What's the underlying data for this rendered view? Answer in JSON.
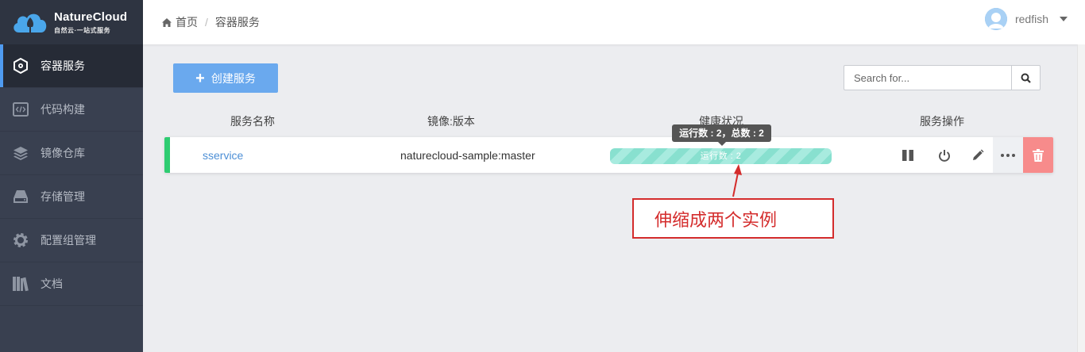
{
  "app": {
    "logo_title": "NatureCloud",
    "logo_subtitle": "自然云·一站式服务"
  },
  "sidebar": {
    "items": [
      {
        "label": "容器服务",
        "icon": "cube-icon",
        "active": true
      },
      {
        "label": "代码构建",
        "icon": "code-icon",
        "active": false
      },
      {
        "label": "镜像仓库",
        "icon": "layers-icon",
        "active": false
      },
      {
        "label": "存储管理",
        "icon": "disk-icon",
        "active": false
      },
      {
        "label": "配置组管理",
        "icon": "gear-icon",
        "active": false
      },
      {
        "label": "文档",
        "icon": "books-icon",
        "active": false
      }
    ]
  },
  "header": {
    "breadcrumb": [
      "首页",
      "/",
      "容器服务"
    ],
    "username": "redfish"
  },
  "toolbar": {
    "create_label": "创建服务",
    "search_placeholder": "Search for..."
  },
  "table": {
    "columns": [
      "服务名称",
      "镜像:版本",
      "健康状况",
      "服务操作"
    ],
    "rows": [
      {
        "name": "sservice",
        "image": "naturecloud-sample:master",
        "health_label": "运行数 : 2",
        "tooltip": "运行数 : 2，总数 : 2",
        "status_color": "#2ecc71"
      }
    ]
  },
  "annotation": {
    "text": "伸缩成两个实例"
  },
  "colors": {
    "sidebar_bg": "#394050",
    "accent": "#4f9bf0",
    "create_button": "#6aa9ee",
    "health_bar": "#88e0cf",
    "delete_button": "#f78b8b",
    "annotation_red": "#d42c2c"
  }
}
